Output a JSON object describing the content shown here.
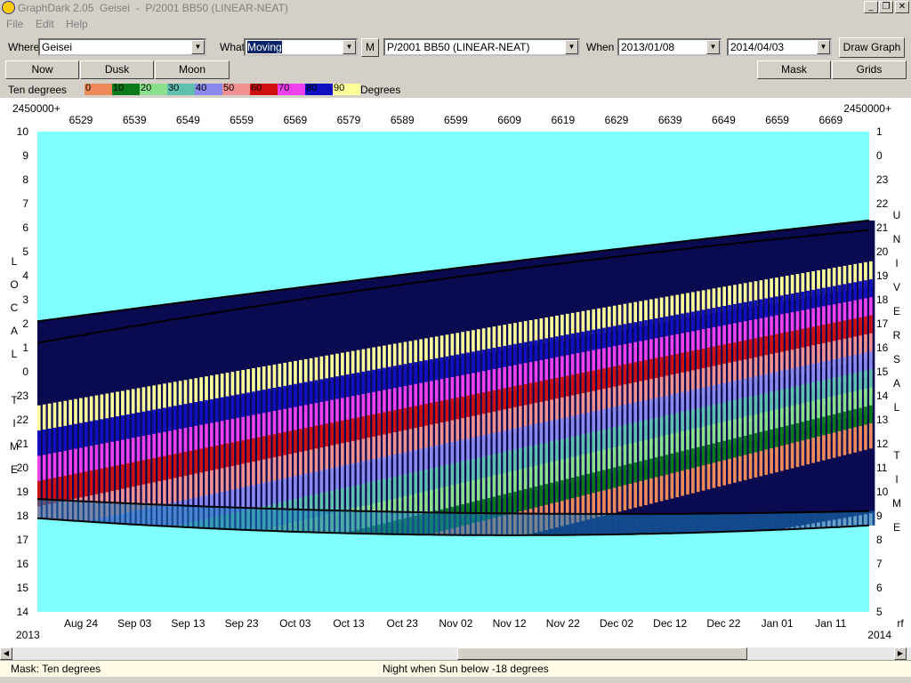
{
  "window": {
    "title": "GraphDark 2.05  Geisei  -  P/2001 BB50 (LINEAR-NEAT)",
    "controls": [
      "_",
      "❐",
      "✕"
    ]
  },
  "menu": [
    "File",
    "Edit",
    "Help"
  ],
  "toolbar": {
    "where_label": "Where",
    "where_value": "Geisei",
    "what_label": "What",
    "what_value": "Moving",
    "m_button": "M",
    "object_value": "P/2001 BB50 (LINEAR-NEAT)",
    "when_label": "When",
    "start_date": "2013/01/08",
    "end_date": "2014/04/03",
    "draw_button": "Draw Graph"
  },
  "buttons": {
    "now": "Now",
    "dusk": "Dusk",
    "moon": "Moon",
    "mask": "Mask",
    "grids": "Grids"
  },
  "legend": {
    "label": "Ten degrees",
    "unit": "Degrees",
    "entries": [
      {
        "text": "0",
        "color": "#ee8a5a"
      },
      {
        "text": "10",
        "color": "#0a7a1a"
      },
      {
        "text": "20",
        "color": "#8ae08a"
      },
      {
        "text": "30",
        "color": "#60c0b0"
      },
      {
        "text": "40",
        "color": "#8a8aee"
      },
      {
        "text": "50",
        "color": "#f09090"
      },
      {
        "text": "60",
        "color": "#d01010"
      },
      {
        "text": "70",
        "color": "#ee40ee"
      },
      {
        "text": "80",
        "color": "#1010c0"
      },
      {
        "text": "90",
        "color": "#ffff99"
      }
    ]
  },
  "chart_data": {
    "type": "heatmap",
    "jd_prefix_left": "2450000+",
    "jd_prefix_right": "2450000+",
    "jd_ticks": [
      "6529",
      "6539",
      "6549",
      "6559",
      "6569",
      "6579",
      "6589",
      "6599",
      "6609",
      "6619",
      "6629",
      "6639",
      "6649",
      "6659",
      "6669"
    ],
    "date_ticks": [
      "Aug 24",
      "Sep 03",
      "Sep 13",
      "Sep 23",
      "Oct 03",
      "Oct 13",
      "Oct 23",
      "Nov 02",
      "Nov 12",
      "Nov 22",
      "Dec 02",
      "Dec 12",
      "Dec 22",
      "Jan 01",
      "Jan 11"
    ],
    "year_left": "2013",
    "year_right": "2014",
    "right_corner": "rf",
    "local_time_ticks": [
      "10",
      "9",
      "8",
      "7",
      "6",
      "5",
      "4",
      "3",
      "2",
      "1",
      "0",
      "23",
      "22",
      "21",
      "20",
      "19",
      "18",
      "17",
      "16",
      "15",
      "14"
    ],
    "universal_time_ticks": [
      "1",
      "0",
      "23",
      "22",
      "21",
      "20",
      "19",
      "18",
      "17",
      "16",
      "15",
      "14",
      "13",
      "12",
      "11",
      "10",
      "9",
      "8",
      "7",
      "6",
      "5"
    ],
    "left_axis_label": [
      "L",
      "O",
      "C",
      "A",
      "L",
      "",
      "T",
      "I",
      "M",
      "E"
    ],
    "right_axis_label": [
      "U",
      "N",
      "I",
      "V",
      "E",
      "R",
      "S",
      "A",
      "L",
      "",
      "T",
      "I",
      "M",
      "E"
    ],
    "day_range": [
      6521,
      6680
    ],
    "hour_range_local": [
      14,
      34
    ],
    "colors": {
      "background": "#80ffff",
      "night": "#0a0a50",
      "moon": "#c8c8d8",
      "moon_twilight": "#1a80c0",
      "curve": "#000000"
    }
  },
  "status": {
    "mask_text": "Mask:  Ten degrees",
    "night_text": "Night when Sun below -18 degrees"
  }
}
